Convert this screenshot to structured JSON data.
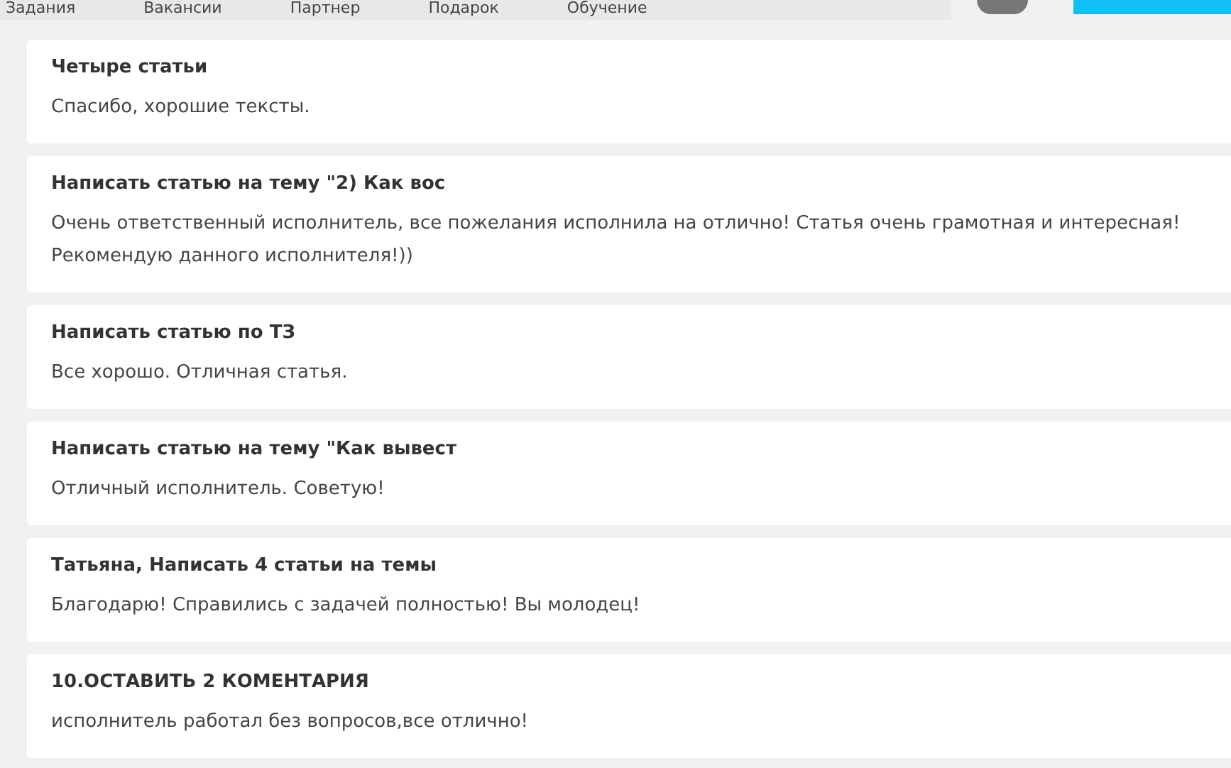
{
  "nav": {
    "items": [
      "Задания",
      "Вакансии",
      "Партнер",
      "Подарок",
      "Обучение"
    ]
  },
  "reviews": [
    {
      "title": "Четыре статьи",
      "text": "Спасибо, хорошие тексты."
    },
    {
      "title": "Написать статью на тему \"2) Как вос",
      "text": "Очень ответственный исполнитель, все пожелания исполнила на отлично! Статья очень грамотная и интересная! Рекомендую данного исполнителя!))"
    },
    {
      "title": "Написать статью по ТЗ",
      "text": "Все хорошо. Отличная статья."
    },
    {
      "title": "Написать статью на тему \"Как вывест",
      "text": "Отличный исполнитель. Советую!"
    },
    {
      "title": "Татьяна, Написать 4 статьи на темы",
      "text": "Благодарю! Справились с задачей полностью! Вы молодец!"
    },
    {
      "title": "10.ОСТАВИТЬ 2 КОМЕНТАРИЯ",
      "text": "исполнитель работал без вопросов,все отлично!"
    }
  ]
}
